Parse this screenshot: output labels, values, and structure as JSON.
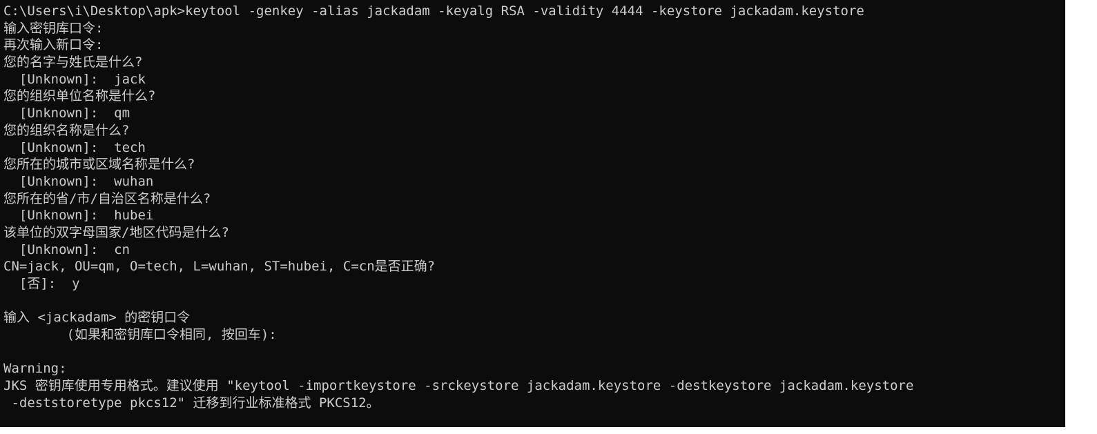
{
  "console": {
    "lines": [
      "C:\\Users\\i\\Desktop\\apk>keytool -genkey -alias jackadam -keyalg RSA -validity 4444 -keystore jackadam.keystore",
      "输入密钥库口令:",
      "再次输入新口令:",
      "您的名字与姓氏是什么?",
      "  [Unknown]:  jack",
      "您的组织单位名称是什么?",
      "  [Unknown]:  qm",
      "您的组织名称是什么?",
      "  [Unknown]:  tech",
      "您所在的城市或区域名称是什么?",
      "  [Unknown]:  wuhan",
      "您所在的省/市/自治区名称是什么?",
      "  [Unknown]:  hubei",
      "该单位的双字母国家/地区代码是什么?",
      "  [Unknown]:  cn",
      "CN=jack, OU=qm, O=tech, L=wuhan, ST=hubei, C=cn是否正确?",
      "  [否]:  y",
      "",
      "输入 <jackadam> 的密钥口令",
      "        (如果和密钥库口令相同, 按回车):",
      "",
      "Warning:",
      "JKS 密钥库使用专用格式。建议使用 \"keytool -importkeystore -srckeystore jackadam.keystore -destkeystore jackadam.keystore",
      " -deststoretype pkcs12\" 迁移到行业标准格式 PKCS12。"
    ]
  },
  "colors": {
    "background": "#0c0c0c",
    "text": "#cccccc",
    "frame": "#ffffff"
  }
}
